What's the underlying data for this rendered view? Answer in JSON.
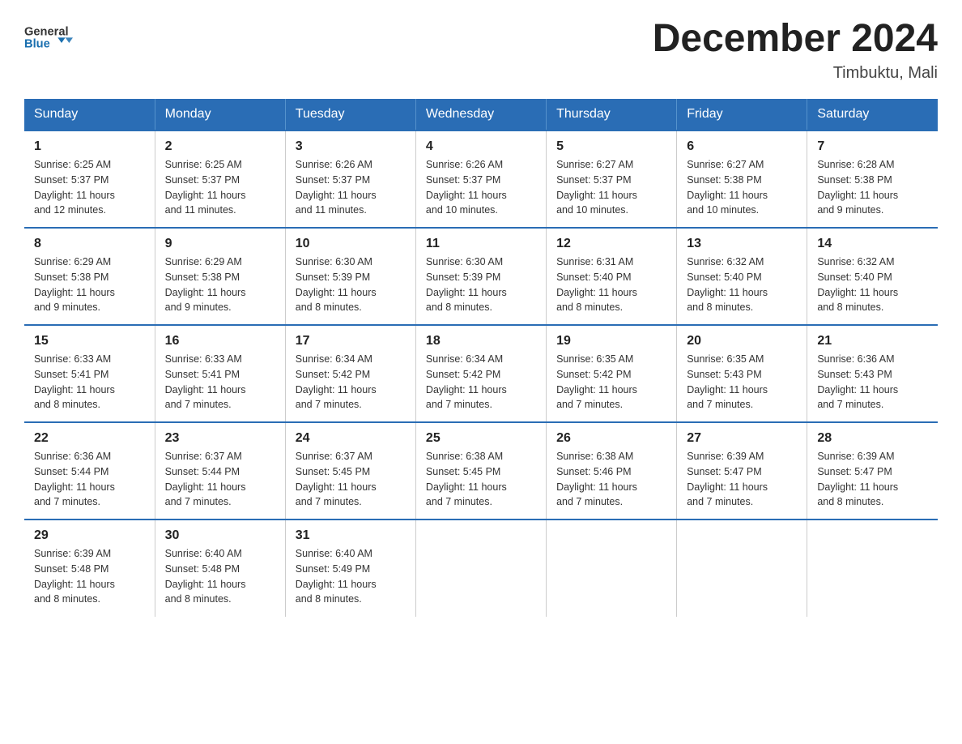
{
  "header": {
    "logo_text_general": "General",
    "logo_text_blue": "Blue",
    "title": "December 2024",
    "subtitle": "Timbuktu, Mali"
  },
  "days_of_week": [
    "Sunday",
    "Monday",
    "Tuesday",
    "Wednesday",
    "Thursday",
    "Friday",
    "Saturday"
  ],
  "weeks": [
    [
      {
        "day": "1",
        "sunrise": "6:25 AM",
        "sunset": "5:37 PM",
        "daylight": "11 hours and 12 minutes."
      },
      {
        "day": "2",
        "sunrise": "6:25 AM",
        "sunset": "5:37 PM",
        "daylight": "11 hours and 11 minutes."
      },
      {
        "day": "3",
        "sunrise": "6:26 AM",
        "sunset": "5:37 PM",
        "daylight": "11 hours and 11 minutes."
      },
      {
        "day": "4",
        "sunrise": "6:26 AM",
        "sunset": "5:37 PM",
        "daylight": "11 hours and 10 minutes."
      },
      {
        "day": "5",
        "sunrise": "6:27 AM",
        "sunset": "5:37 PM",
        "daylight": "11 hours and 10 minutes."
      },
      {
        "day": "6",
        "sunrise": "6:27 AM",
        "sunset": "5:38 PM",
        "daylight": "11 hours and 10 minutes."
      },
      {
        "day": "7",
        "sunrise": "6:28 AM",
        "sunset": "5:38 PM",
        "daylight": "11 hours and 9 minutes."
      }
    ],
    [
      {
        "day": "8",
        "sunrise": "6:29 AM",
        "sunset": "5:38 PM",
        "daylight": "11 hours and 9 minutes."
      },
      {
        "day": "9",
        "sunrise": "6:29 AM",
        "sunset": "5:38 PM",
        "daylight": "11 hours and 9 minutes."
      },
      {
        "day": "10",
        "sunrise": "6:30 AM",
        "sunset": "5:39 PM",
        "daylight": "11 hours and 8 minutes."
      },
      {
        "day": "11",
        "sunrise": "6:30 AM",
        "sunset": "5:39 PM",
        "daylight": "11 hours and 8 minutes."
      },
      {
        "day": "12",
        "sunrise": "6:31 AM",
        "sunset": "5:40 PM",
        "daylight": "11 hours and 8 minutes."
      },
      {
        "day": "13",
        "sunrise": "6:32 AM",
        "sunset": "5:40 PM",
        "daylight": "11 hours and 8 minutes."
      },
      {
        "day": "14",
        "sunrise": "6:32 AM",
        "sunset": "5:40 PM",
        "daylight": "11 hours and 8 minutes."
      }
    ],
    [
      {
        "day": "15",
        "sunrise": "6:33 AM",
        "sunset": "5:41 PM",
        "daylight": "11 hours and 8 minutes."
      },
      {
        "day": "16",
        "sunrise": "6:33 AM",
        "sunset": "5:41 PM",
        "daylight": "11 hours and 7 minutes."
      },
      {
        "day": "17",
        "sunrise": "6:34 AM",
        "sunset": "5:42 PM",
        "daylight": "11 hours and 7 minutes."
      },
      {
        "day": "18",
        "sunrise": "6:34 AM",
        "sunset": "5:42 PM",
        "daylight": "11 hours and 7 minutes."
      },
      {
        "day": "19",
        "sunrise": "6:35 AM",
        "sunset": "5:42 PM",
        "daylight": "11 hours and 7 minutes."
      },
      {
        "day": "20",
        "sunrise": "6:35 AM",
        "sunset": "5:43 PM",
        "daylight": "11 hours and 7 minutes."
      },
      {
        "day": "21",
        "sunrise": "6:36 AM",
        "sunset": "5:43 PM",
        "daylight": "11 hours and 7 minutes."
      }
    ],
    [
      {
        "day": "22",
        "sunrise": "6:36 AM",
        "sunset": "5:44 PM",
        "daylight": "11 hours and 7 minutes."
      },
      {
        "day": "23",
        "sunrise": "6:37 AM",
        "sunset": "5:44 PM",
        "daylight": "11 hours and 7 minutes."
      },
      {
        "day": "24",
        "sunrise": "6:37 AM",
        "sunset": "5:45 PM",
        "daylight": "11 hours and 7 minutes."
      },
      {
        "day": "25",
        "sunrise": "6:38 AM",
        "sunset": "5:45 PM",
        "daylight": "11 hours and 7 minutes."
      },
      {
        "day": "26",
        "sunrise": "6:38 AM",
        "sunset": "5:46 PM",
        "daylight": "11 hours and 7 minutes."
      },
      {
        "day": "27",
        "sunrise": "6:39 AM",
        "sunset": "5:47 PM",
        "daylight": "11 hours and 7 minutes."
      },
      {
        "day": "28",
        "sunrise": "6:39 AM",
        "sunset": "5:47 PM",
        "daylight": "11 hours and 8 minutes."
      }
    ],
    [
      {
        "day": "29",
        "sunrise": "6:39 AM",
        "sunset": "5:48 PM",
        "daylight": "11 hours and 8 minutes."
      },
      {
        "day": "30",
        "sunrise": "6:40 AM",
        "sunset": "5:48 PM",
        "daylight": "11 hours and 8 minutes."
      },
      {
        "day": "31",
        "sunrise": "6:40 AM",
        "sunset": "5:49 PM",
        "daylight": "11 hours and 8 minutes."
      },
      null,
      null,
      null,
      null
    ]
  ],
  "labels": {
    "sunrise": "Sunrise:",
    "sunset": "Sunset:",
    "daylight": "Daylight:"
  }
}
